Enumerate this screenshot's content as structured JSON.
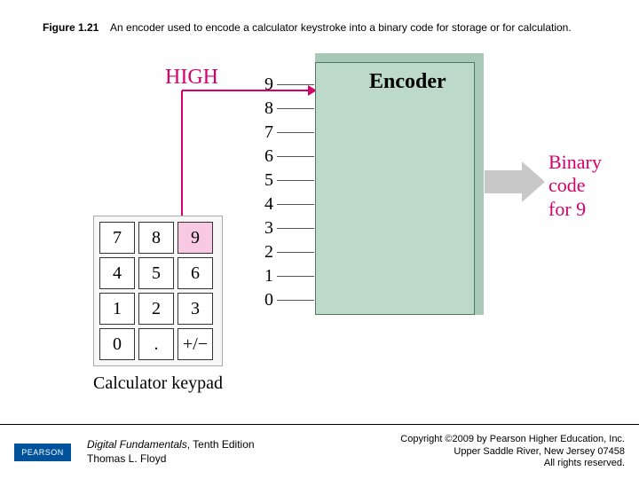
{
  "figure": {
    "number": "Figure 1.21",
    "caption": "An encoder used to encode a calculator keystroke into a binary code for storage or for calculation."
  },
  "diagram": {
    "high_label": "HIGH",
    "encoder_label": "Encoder",
    "output_label_line1": "Binary",
    "output_label_line2": "code for 9",
    "input_numbers": [
      "9",
      "8",
      "7",
      "6",
      "5",
      "4",
      "3",
      "2",
      "1",
      "0"
    ],
    "keypad": {
      "label": "Calculator keypad",
      "keys": [
        {
          "label": "7",
          "pressed": false
        },
        {
          "label": "8",
          "pressed": false
        },
        {
          "label": "9",
          "pressed": true
        },
        {
          "label": "4",
          "pressed": false
        },
        {
          "label": "5",
          "pressed": false
        },
        {
          "label": "6",
          "pressed": false
        },
        {
          "label": "1",
          "pressed": false
        },
        {
          "label": "2",
          "pressed": false
        },
        {
          "label": "3",
          "pressed": false
        },
        {
          "label": "0",
          "pressed": false
        },
        {
          "label": ".",
          "pressed": false
        },
        {
          "label": "+/−",
          "pressed": false
        }
      ]
    }
  },
  "footer": {
    "logo": "PEARSON",
    "book_title": "Digital Fundamentals",
    "edition": ", Tenth Edition",
    "author": "Thomas L. Floyd",
    "copyright_line1": "Copyright ©2009 by Pearson Higher Education, Inc.",
    "copyright_line2": "Upper Saddle River, New Jersey 07458",
    "copyright_line3": "All rights reserved."
  }
}
